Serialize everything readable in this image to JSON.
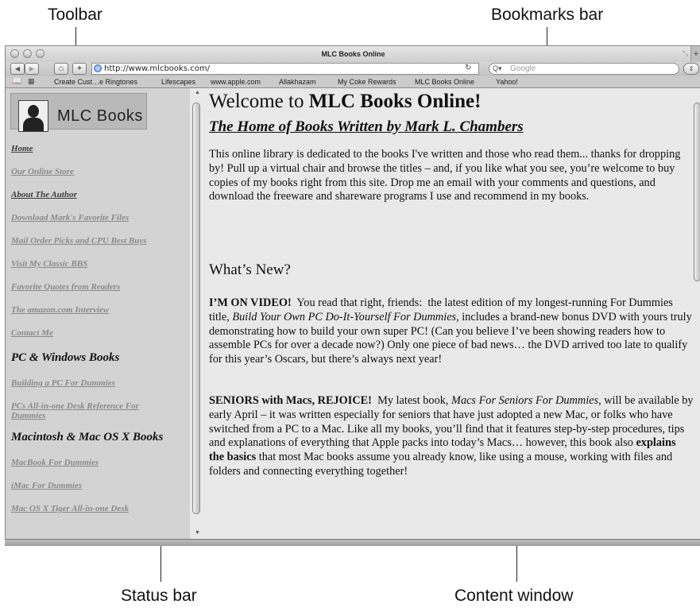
{
  "callouts": {
    "toolbar": "Toolbar",
    "bookmarks_bar": "Bookmarks bar",
    "status_bar": "Status bar",
    "content_window": "Content window"
  },
  "window": {
    "title": "MLC Books Online"
  },
  "toolbar": {
    "back_glyph": "◀",
    "forward_glyph": "▶",
    "home_glyph": "⌂",
    "add_bookmark_glyph": "+",
    "url": "http://www.mlcbooks.com/",
    "reload_glyph": "↻",
    "search_placeholder": "Google",
    "search_icon_glyph": "Q▾",
    "tab_plus": "+"
  },
  "bookmarks_bar": {
    "items": [
      "Create Cust…e Ringtones",
      "Lifescapes",
      "www.apple.com",
      "Allakhazam",
      "My Coke Rewards",
      "MLC Books Online",
      "Yahoo!"
    ]
  },
  "sidebar": {
    "logo_text": "MLC Books",
    "links": [
      "Home",
      "Our Online Store",
      "About The Author",
      "Download Mark's Favorite Files",
      "Mail Order Picks and CPU Best Buys",
      "Visit My Classic BBS",
      "Favorite Quotes from Readers",
      "The amazon.com Interview",
      "Contact Me"
    ],
    "section_pc": "PC & Windows Books",
    "pc_links": [
      "Building a PC For Dummies",
      "PCs All-in-one Desk Reference For",
      "Dummies"
    ],
    "section_mac": "Macintosh & Mac OS X Books",
    "mac_links": [
      "MacBook For Dummies",
      "iMac For Dummies",
      "Mac OS X Tiger All-in-one Desk"
    ]
  },
  "main": {
    "welcome_prefix": "Welcome to ",
    "welcome_bold": "MLC Books Online!",
    "subtitle": "The Home of Books Written by Mark L. Chambers",
    "intro": "This online library is dedicated to the books I've written and those who read them... thanks for dropping by! Pull up a virtual chair and browse the titles – and, if you like what you see, you’re welcome to buy copies of my books right from this site. Drop me an email with your comments and questions, and download the freeware and shareware programs I use and recommend in my books.",
    "whats_new": "What’s New?",
    "video_bold": "I’M ON VIDEO!",
    "video_text_1": "  You read that right, friends:  the latest edition of my longest-running For Dummies title, ",
    "video_italic": "Build Your Own PC Do-It-Yourself For Dummies",
    "video_text_2": ", includes a brand-new bonus DVD with yours truly demonstrating how to build your own super PC! (Can you believe I’ve been showing readers how to assemble PCs for over a decade now?) Only one piece of bad news… the DVD arrived too late to qualify for this year’s Oscars, but there’s always next year!",
    "seniors_bold": "SENIORS with Macs, REJOICE!",
    "seniors_text_1": "  My latest book, ",
    "seniors_italic": "Macs For Seniors For Dummies,",
    "seniors_text_2": " will be available by early April – it was written especially for seniors that have just adopted a new Mac, or folks who have switched from a PC to a Mac. Like all my books, you’ll find that it features step-by-step procedures, tips and explanations of everything that Apple packs into today’s Macs… however, this book also ",
    "seniors_bold_2": "explains the basics",
    "seniors_text_3": " that most Mac books assume you already know, like using a mouse, working with files and folders and connecting everything together!"
  }
}
